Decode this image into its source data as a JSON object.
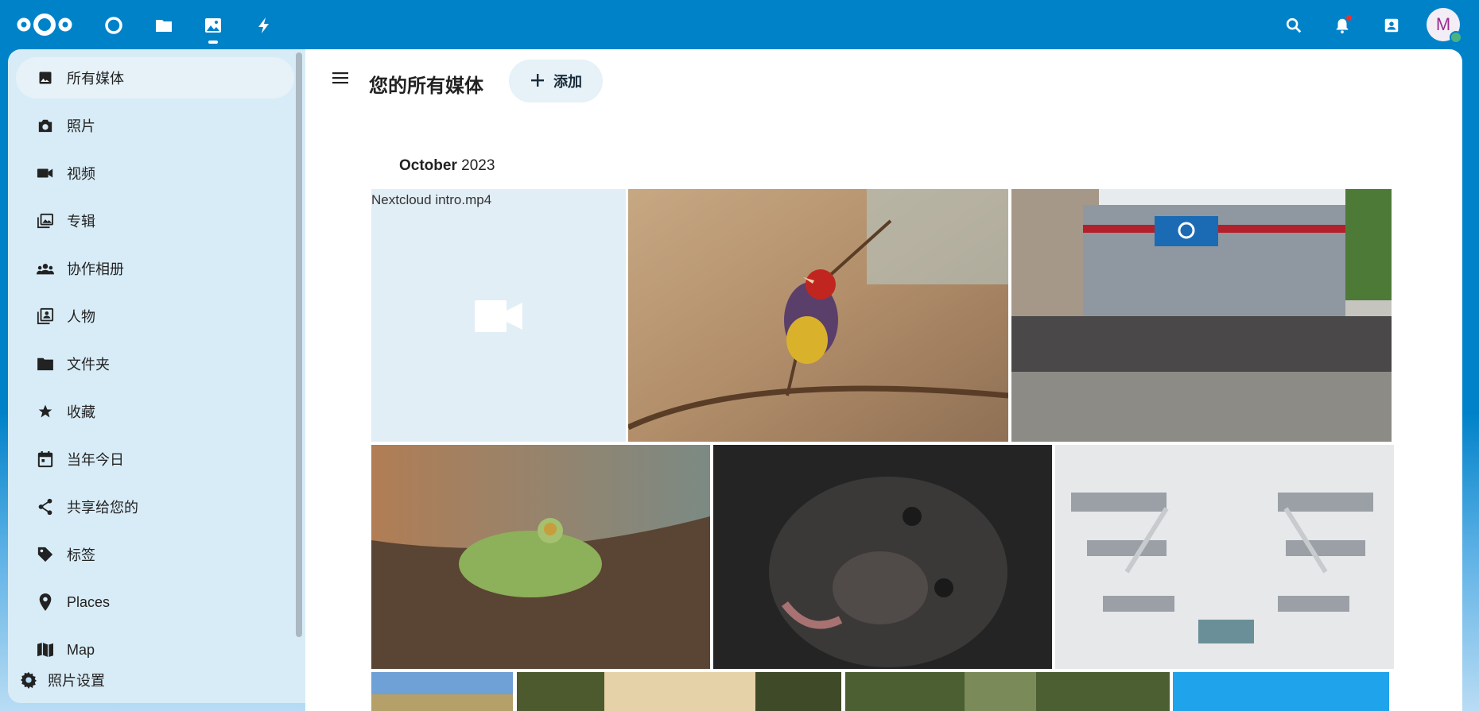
{
  "topbar": {
    "logo": "nextcloud-logo",
    "apps": [
      {
        "name": "dashboard-icon"
      },
      {
        "name": "files-icon"
      },
      {
        "name": "photos-icon",
        "active": true
      },
      {
        "name": "activity-icon"
      }
    ],
    "right_icons": [
      "search-icon",
      "bell-icon",
      "contacts-icon"
    ],
    "avatar_initial": "M",
    "accent_color": "#0082c9"
  },
  "sidebar": {
    "items": [
      {
        "label": "所有媒体",
        "icon": "image-icon",
        "active": true
      },
      {
        "label": "照片",
        "icon": "camera-icon"
      },
      {
        "label": "视频",
        "icon": "video-icon"
      },
      {
        "label": "专辑",
        "icon": "album-icon"
      },
      {
        "label": "协作相册",
        "icon": "people-icon"
      },
      {
        "label": "人物",
        "icon": "contact-book-icon"
      },
      {
        "label": "文件夹",
        "icon": "folder-icon"
      },
      {
        "label": "收藏",
        "icon": "star-icon"
      },
      {
        "label": "当年今日",
        "icon": "calendar-icon"
      },
      {
        "label": "共享给您的",
        "icon": "share-icon"
      },
      {
        "label": "标签",
        "icon": "tag-icon"
      },
      {
        "label": "Places",
        "icon": "map-marker-icon"
      },
      {
        "label": "Map",
        "icon": "map-icon"
      }
    ],
    "settings_label": "照片设置"
  },
  "main": {
    "title": "您的所有媒体",
    "add_label": "添加",
    "month_name": "October",
    "month_year": "2023",
    "video_label": "Nextcloud intro.mp4"
  }
}
